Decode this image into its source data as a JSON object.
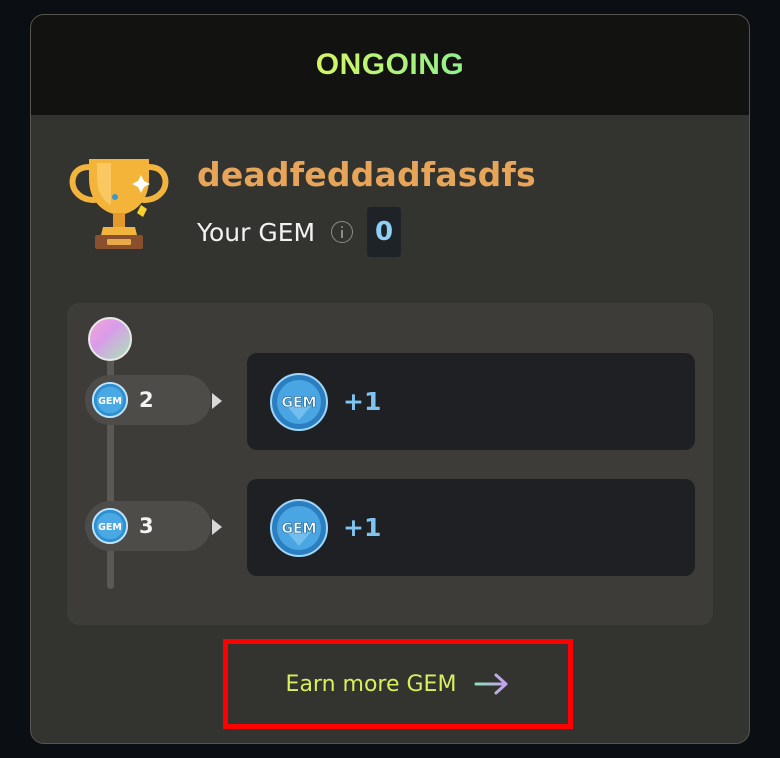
{
  "header": {
    "title": "ONGOING"
  },
  "profile": {
    "username": "deadfeddadfasdfs",
    "gem_label": "Your GEM",
    "gem_value": "0"
  },
  "icons": {
    "trophy": "trophy-icon",
    "info": "info-icon",
    "gem": "gem-icon",
    "arrow": "arrow-right-icon"
  },
  "steps": [
    {
      "number": "2",
      "reward_amount": "+1",
      "badge_text": "GEM"
    },
    {
      "number": "3",
      "reward_amount": "+1",
      "badge_text": "GEM"
    }
  ],
  "footer": {
    "earn_label": "Earn more GEM"
  },
  "colors": {
    "header_gradient_start": "#d7f564",
    "header_gradient_end": "#90f08e",
    "username": "#e7a55a",
    "gem_value": "#8ed0f5",
    "reward_amount": "#7fc4f0",
    "earn_label": "#d7f05c",
    "highlight_border": "#ff0000"
  }
}
